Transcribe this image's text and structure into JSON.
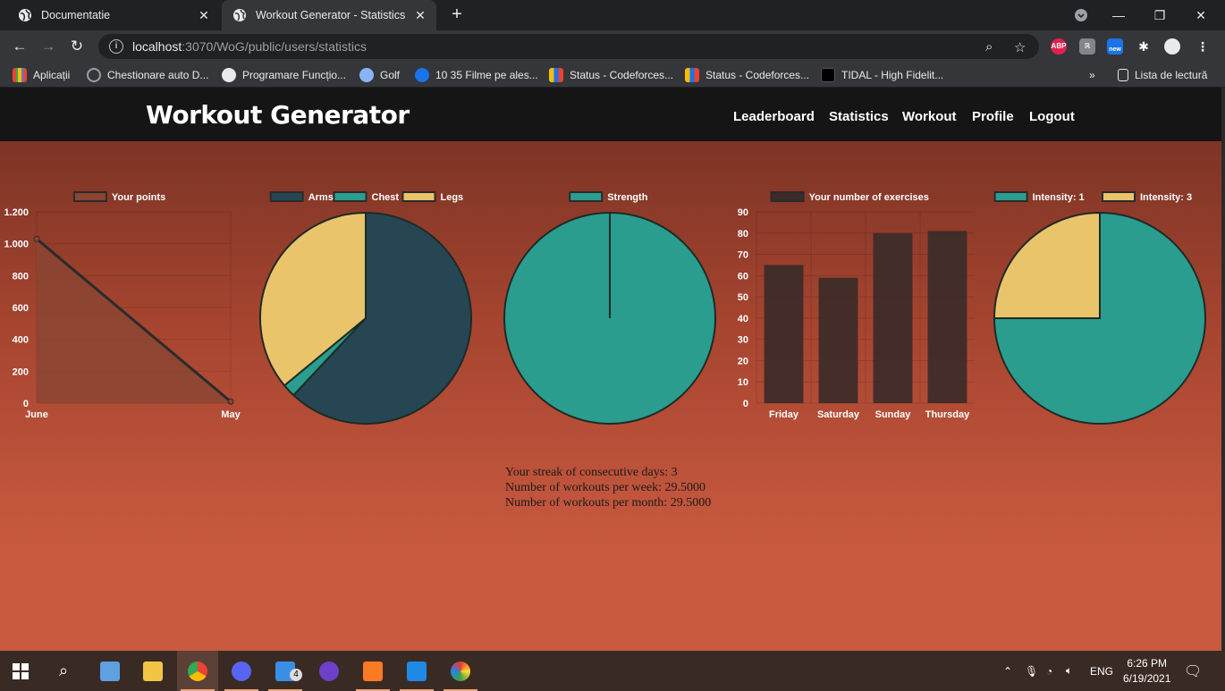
{
  "browser": {
    "tabs": [
      {
        "title": "Documentatie",
        "close": "✕"
      },
      {
        "title": "Workout Generator - Statistics",
        "close": "✕"
      }
    ],
    "new_tab": "+",
    "window_controls": {
      "minimize": "—",
      "restore": "❐",
      "close": "✕"
    },
    "address": {
      "host": "localhost",
      "path": ":3070/WoG/public/users/statistics"
    },
    "extensions": {
      "abp": "ABP",
      "new_badge": "new"
    },
    "bookmarks": [
      {
        "label": "Aplicații",
        "color": "#ea4335"
      },
      {
        "label": "Chestionare auto D...",
        "color": "#9aa0a6"
      },
      {
        "label": "Programare Funcțio...",
        "color": "#e8eaed"
      },
      {
        "label": "Golf",
        "color": "#8ab4f8"
      },
      {
        "label": "10 35 Filme pe ales...",
        "color": "#1a73e8"
      },
      {
        "label": "Status - Codeforces...",
        "color": "#fbbc04"
      },
      {
        "label": "Status - Codeforces...",
        "color": "#fbbc04"
      },
      {
        "label": "TIDAL - High Fidelit...",
        "color": "#000000"
      }
    ],
    "bookmarks_overflow": "»",
    "reading_list": "Lista de lectură"
  },
  "site": {
    "brand": "Workout Generator",
    "nav": [
      "Leaderboard",
      "Statistics",
      "Workout",
      "Profile",
      "Logout"
    ]
  },
  "colors": {
    "dark_slate": "#264653",
    "teal": "#2a9d8f",
    "sand": "#e9c46a",
    "brown_fill": "#8a4533",
    "bar_fill": "#3c2b28"
  },
  "chart_data": [
    {
      "type": "line",
      "legend": [
        "Your points"
      ],
      "categories": [
        "June",
        "May"
      ],
      "series": [
        {
          "name": "Your points",
          "values": [
            1030,
            10
          ]
        }
      ],
      "ylim": [
        0,
        1200
      ],
      "yticks": [
        "0",
        "200",
        "400",
        "600",
        "800",
        "1.000",
        "1.200"
      ],
      "grid": true
    },
    {
      "type": "pie",
      "legend": [
        "Arms",
        "Chest",
        "Legs"
      ],
      "values": [
        62,
        2,
        36
      ]
    },
    {
      "type": "pie",
      "legend": [
        "Strength"
      ],
      "values": [
        100
      ]
    },
    {
      "type": "bar",
      "legend": [
        "Your number of exercises"
      ],
      "categories": [
        "Friday",
        "Saturday",
        "Sunday",
        "Thursday"
      ],
      "values": [
        65,
        59,
        80,
        81
      ],
      "ylim": [
        0,
        90
      ],
      "yticks": [
        "0",
        "10",
        "20",
        "30",
        "40",
        "50",
        "60",
        "70",
        "80",
        "90"
      ],
      "grid": true
    },
    {
      "type": "pie",
      "legend": [
        "Intensity: 1",
        "Intensity: 3"
      ],
      "values": [
        75,
        25
      ]
    }
  ],
  "stats": {
    "streak": "Your streak of consecutive days: 3",
    "per_week": "Number of workouts per week: 29.5000",
    "per_month": "Number of workouts per month: 29.5000"
  },
  "taskbar": {
    "lang": "ENG",
    "time": "6:26 PM",
    "date": "6/19/2021",
    "mail_badge": "4"
  }
}
